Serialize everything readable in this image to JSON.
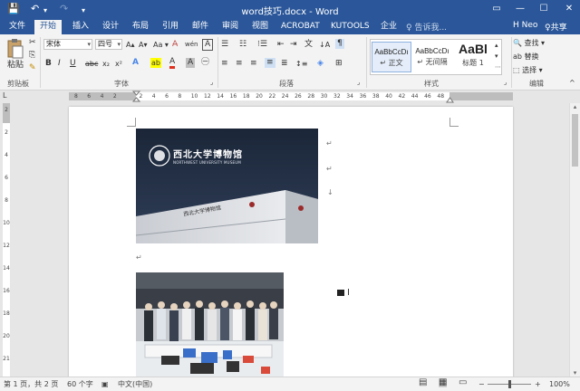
{
  "window": {
    "title": "word技巧.docx - Word",
    "controls": {
      "ribbon_display": "▭",
      "minimize": "—",
      "maximize": "☐",
      "close": "✕"
    }
  },
  "quick_access": {
    "save": "💾",
    "undo": "↶",
    "undo_dd": "▾",
    "redo": "↷",
    "customize": "▾"
  },
  "tabs": [
    "文件",
    "开始",
    "插入",
    "设计",
    "布局",
    "引用",
    "邮件",
    "审阅",
    "视图",
    "ACROBAT",
    "KUTOOLS",
    "企业"
  ],
  "active_tab": "开始",
  "tell_me": "♀ 告诉我...",
  "user": "H Neo",
  "share": "♀共享",
  "ribbon": {
    "clipboard": {
      "paste": "粘贴",
      "label": "剪贴板",
      "cut": "✂",
      "copy": "⎘",
      "format_painter": "✎"
    },
    "font": {
      "family": "宋体",
      "size": "四号",
      "grow": "A▴",
      "shrink": "A▾",
      "case": "Aa ▾",
      "clear": "A̶",
      "wen": "wén",
      "char_border": "A",
      "bold": "B",
      "italic": "I",
      "underline": "U",
      "strikethrough": "abc",
      "subscript": "x₂",
      "superscript": "x²",
      "text_effects": "A",
      "highlight": "ab",
      "font_color": "A",
      "shading": "A",
      "char_circle": "㊀",
      "label": "字体",
      "launcher": "⌟"
    },
    "paragraph": {
      "bullets": "☰",
      "numbering": "☷",
      "multilevel": "⁝☰",
      "decrease_indent": "⇤",
      "increase_indent": "⇥",
      "chinese_layout": "文",
      "sort": "↓A",
      "show_marks": "¶",
      "align_left": "≡",
      "center": "≡",
      "align_right": "≡",
      "justify": "≡",
      "distributed": "≣",
      "line_spacing": "↕≡",
      "shading": "◈",
      "borders": "⊞",
      "label": "段落",
      "launcher": "⌟"
    },
    "styles": {
      "items": [
        {
          "sample": "AaBbCcDı",
          "name": "↵ 正文"
        },
        {
          "sample": "AaBbCcDı",
          "name": "↵ 无间隔"
        },
        {
          "sample": "AaBl",
          "name": "标题 1"
        }
      ],
      "label": "样式",
      "scroll_up": "▴",
      "scroll_down": "▾",
      "more": "⋯",
      "launcher": "⌟"
    },
    "editing": {
      "find": "🔍 查找 ▾",
      "replace": "ab 替换",
      "select": "⬚ 选择 ▾",
      "label": "编辑",
      "collapse": "^"
    }
  },
  "ruler": {
    "ticks": [
      "8",
      "6",
      "4",
      "2",
      "",
      "2",
      "4",
      "6",
      "8",
      "10",
      "12",
      "14",
      "16",
      "18",
      "20",
      "22",
      "24",
      "26",
      "28",
      "30",
      "32",
      "34",
      "36",
      "38",
      "40",
      "42",
      "44",
      "46",
      "48"
    ],
    "tab_selector": "L",
    "vticks": [
      "2",
      "2",
      "4",
      "6",
      "8",
      "10",
      "12",
      "14",
      "16",
      "18",
      "20",
      "21"
    ]
  },
  "document": {
    "image1": {
      "logo_cn": "西北大学博物馆",
      "logo_en": "NORTHWEST UNIVERSITY MUSEUM",
      "wall_text": "西北大学博物馆"
    },
    "para_marks": [
      "↵",
      "↵",
      "↓",
      "↵",
      "↵"
    ]
  },
  "scrollbar": {
    "up": "▴",
    "down": "▾"
  },
  "statusbar": {
    "page": "第 1 页，共 2 页",
    "words": "60 个字",
    "proof": "▣",
    "language": "中文(中国)",
    "read_mode": "▤",
    "print_layout": "▦",
    "web_layout": "▭",
    "zoom_out": "−",
    "zoom_in": "+",
    "zoom": "100%",
    "zoom_level": 0.5
  }
}
